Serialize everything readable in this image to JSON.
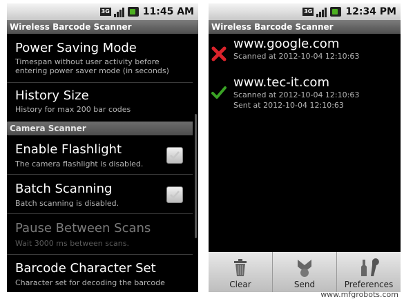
{
  "left_screen": {
    "status": {
      "network": "3G",
      "time": "11:45 AM"
    },
    "title": "Wireless Barcode Scanner",
    "prefs": [
      {
        "title": "Power Saving Mode",
        "summary": "Timespan without user activity before entering power saver mode (in seconds)"
      },
      {
        "title": "History Size",
        "summary": "History for max 200 bar codes"
      }
    ],
    "category": "Camera Scanner",
    "camera_prefs": [
      {
        "title": "Enable Flashlight",
        "summary": "The camera flashlight is disabled.",
        "checked": true
      },
      {
        "title": "Batch Scanning",
        "summary": "Batch scanning is disabled.",
        "checked": true
      },
      {
        "title": "Pause Between Scans",
        "summary": "Wait 3000 ms between scans.",
        "enabled": false
      },
      {
        "title": "Barcode Character Set",
        "summary": "Character set for decoding the barcode"
      }
    ]
  },
  "right_screen": {
    "status": {
      "network": "3G",
      "time": "12:34 PM"
    },
    "title": "Wireless Barcode Scanner",
    "history": [
      {
        "icon": "x-icon",
        "url": "www.google.com",
        "scanned": "Scanned at 2012-10-04 12:10:63",
        "sent": ""
      },
      {
        "icon": "check-icon",
        "url": "www.tec-it.com",
        "scanned": "Scanned at 2012-10-04 12:10:63",
        "sent": "Sent at 2012-10-04 12:10:63"
      }
    ],
    "toolbar": {
      "clear": "Clear",
      "send": "Send",
      "preferences": "Preferences"
    }
  },
  "watermark": "www.mfgrobots.com",
  "colors": {
    "x": "#d9232b",
    "check": "#3aa325"
  }
}
